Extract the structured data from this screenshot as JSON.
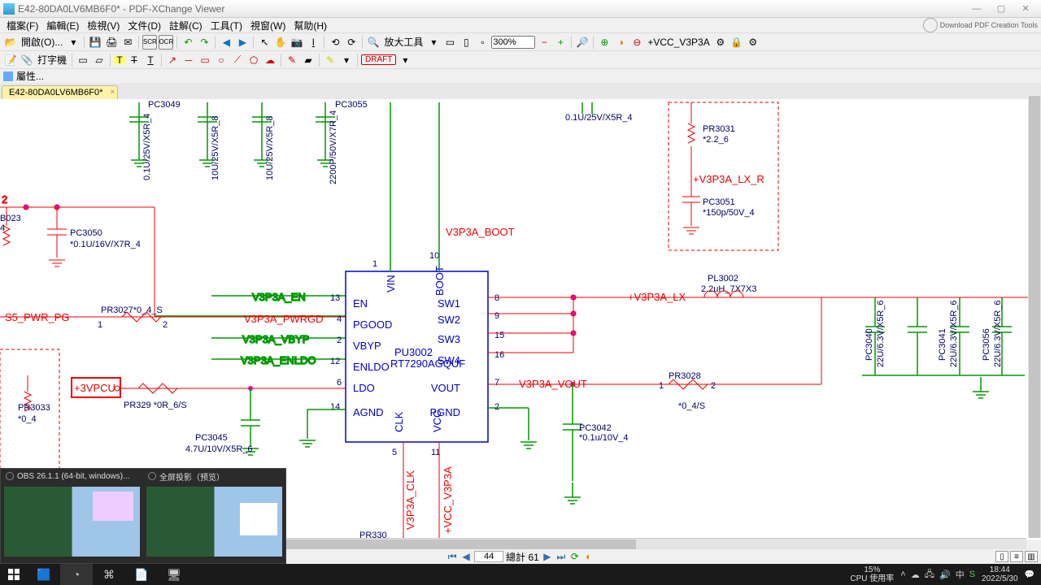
{
  "window": {
    "title": "E42-80DA0LV6MB6F0* - PDF-XChange Viewer",
    "download_label": "Download PDF Creation Tools"
  },
  "menu": {
    "items": [
      "檔案(F)",
      "編輯(E)",
      "檢視(V)",
      "文件(D)",
      "註解(C)",
      "工具(T)",
      "視窗(W)",
      "幫助(H)"
    ]
  },
  "toolbar1": {
    "open_label": "開啟(O)...",
    "zoom_tool_label": "放大工具",
    "zoom_value": "300%",
    "layer_text": "+VCC_V3P3A"
  },
  "toolbar2": {
    "typewriter_label": "打字機",
    "stamp": "DRAFT"
  },
  "props_bar": {
    "label": "屬性..."
  },
  "doc_tab": {
    "label": "E42-80DA0LV6MB6F0*"
  },
  "page_nav": {
    "current": "44",
    "total_label": "總計 61"
  },
  "schematic": {
    "refdes": {
      "PC3049": "PC3049",
      "PC3055": "PC3055",
      "PC3050_ref": "PC3050",
      "PC3050_val": "*0.1U/16V/X7R_4",
      "PR3031_ref": "PR3031",
      "PR3031_val": "*2.2_6",
      "PC3051_ref": "PC3051",
      "PC3051_val": "*150p/50V_4",
      "PL3002_ref": "PL3002",
      "PL3002_val": "2.2uH_7X7X3",
      "PR3028_ref": "PR3028",
      "PR3028_val": "*0_4/S",
      "PR3027": "PR3027*0_4_S",
      "PC3045_ref": "PC3045",
      "PC3045_val": "4.7U/10V/X5R_6",
      "PR329": "PR329 *0R_6/S",
      "PR3033_ref": "PR3033",
      "PR3033_val": "*0_4",
      "PC3042_ref": "PC3042",
      "PC3042_val": "*0.1u/10V_4",
      "cap_right_val": "0.1U/25V/X5R_4",
      "left_B023": "B023",
      "left_4": "4",
      "cap1v": "0.1U/25V/X5R_4",
      "cap2v": "10U/25V/X5R_8",
      "cap3v": "10U/25V/X5R_8",
      "cap4v": "2200P/50V/X7R_4",
      "PC3040_ref": "PC3040",
      "PC3040_val": "22U/6.3V/X5R_6",
      "PC3041_ref": "PC3041",
      "PC3041_val": "22U/6.3V/X5R_6",
      "PC3056_ref": "PC3056",
      "PC3056_val": "22U/6.3V/X5R_6",
      "PR330": "PR330",
      "left_edge_2": "2"
    },
    "nets": {
      "V3P3A_EN": "V3P3A_EN",
      "V3P3A_PWRGD": "V3P3A_PWRGD",
      "V3P3A_VBYP": "V3P3A_VBYP",
      "V3P3A_ENLDO": "V3P3A_ENLDO",
      "V3P3A_LX": "+V3P3A_LX",
      "V3P3A_VOUT": "V3P3A_VOUT",
      "V3P3A_LX_R": "+V3P3A_LX_R",
      "V3P3A_BOOT": "V3P3A_BOOT",
      "S5_PWR_PG": "S5_PWR_PG",
      "plus3VPCU": "+3VPCU",
      "V3P3A_CLK": "V3P3A_CLK",
      "VCC_V3P3A": "+VCC_V3P3A"
    },
    "ic": {
      "ref": "PU3002",
      "part": "RT7290AGQUF",
      "EN": "EN",
      "PGOOD": "PGOOD",
      "VBYP": "VBYP",
      "ENLDO": "ENLDO",
      "LDO": "LDO",
      "AGND": "AGND",
      "SW1": "SW1",
      "SW2": "SW2",
      "SW3": "SW3",
      "SW4": "SW4",
      "VOUT": "VOUT",
      "PGND": "PGND",
      "VIN": "VIN",
      "BOOT": "BOOT",
      "CLK": "CLK",
      "VCC": "VCC",
      "p1": "1",
      "p2": "2",
      "p4": "4",
      "p5": "5",
      "p6": "6",
      "p7": "7",
      "p8": "8",
      "p9": "9",
      "p10": "10",
      "p11": "11",
      "p12": "12",
      "p13": "13",
      "p14": "14",
      "p15": "15",
      "p16": "16",
      "lp1": "1",
      "rp2": "2",
      "ldop1": "1"
    }
  },
  "tray": {
    "cpu_pct": "15%",
    "cpu_label": "CPU 使用率",
    "ime": "中",
    "time": "18:44",
    "date": "2022/5/30"
  },
  "obs": {
    "t1": "OBS 26.1.1 (64-bit, windows)...",
    "t2": "全屏投影（预览）"
  }
}
